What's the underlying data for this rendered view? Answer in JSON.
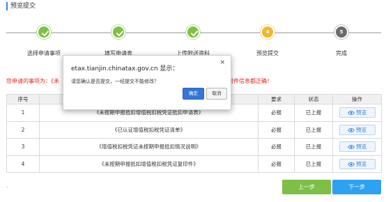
{
  "section_title": "预览提交",
  "steps": [
    {
      "label": "选择申请事项",
      "status": "done"
    },
    {
      "label": "填写申请表",
      "status": "done"
    },
    {
      "label": "上传附送资料",
      "status": "done"
    },
    {
      "label": "预览提交",
      "status": "current",
      "number": "4"
    },
    {
      "label": "完成",
      "status": "todo",
      "number": "5"
    }
  ],
  "notice": {
    "head": "您申请的事项为：《未",
    "tail": "传附件信息都正确！"
  },
  "table": {
    "headers": [
      "序号",
      "",
      "要求",
      "状态",
      "操作"
    ],
    "rows": [
      {
        "no": "1",
        "name": "《未按期申报抵扣增值税扣税凭证抵扣申请表》",
        "req": "必报",
        "status": "已上报",
        "action": "预览"
      },
      {
        "no": "2",
        "name": "《已认证增值税扣税凭证清单》",
        "req": "必报",
        "status": "已上报",
        "action": "预览"
      },
      {
        "no": "3",
        "name": "《增值税扣税凭证未按期申报抵扣情况说明》",
        "req": "必报",
        "status": "已上报",
        "action": "预览"
      },
      {
        "no": "4",
        "name": "《未按期申报抵扣增值税扣税凭证复印件》",
        "req": "必报",
        "status": "已上报",
        "action": "预览"
      }
    ]
  },
  "footer": {
    "dot": ".",
    "prev_label": "上一步",
    "next_label": "下一步"
  },
  "dialog": {
    "title": "etax.tianjin.chinatax.gov.cn 显示：",
    "close": "×",
    "message": "请您确认是否提交，一经提交不能修改？",
    "ok_label": "确定",
    "cancel_label": "取消"
  },
  "colors": {
    "done": "#7cc242",
    "current": "#f2b62a",
    "todo": "#6b6b6b",
    "accent_blue": "#2da2f1",
    "accent_green": "#7dc045",
    "warning_red": "#e8241d"
  },
  "icons": {
    "done": "check-icon",
    "preview": "eye-icon",
    "close": "close-icon"
  }
}
